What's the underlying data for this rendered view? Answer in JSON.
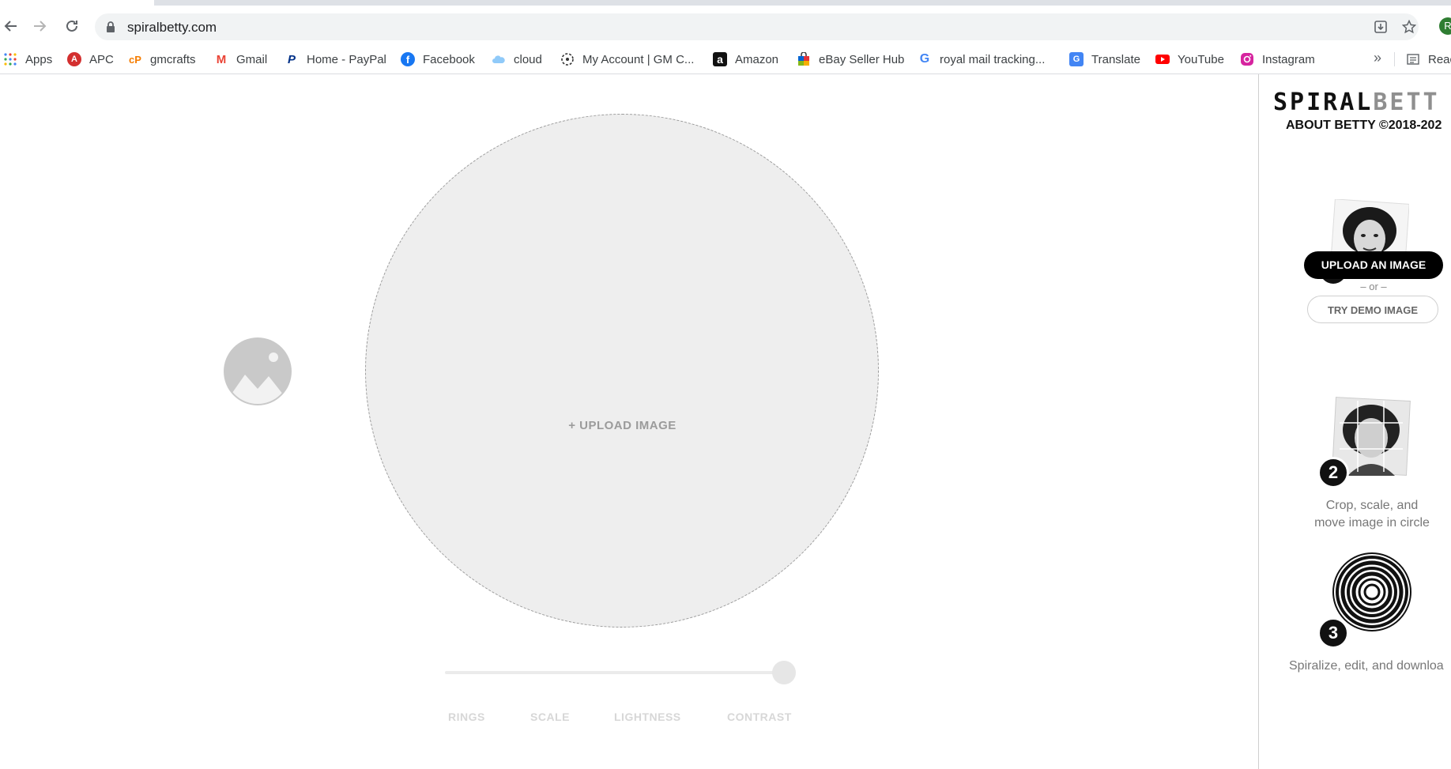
{
  "browser": {
    "url": "spiralbetty.com",
    "avatar_initial": "R"
  },
  "bookmarks": [
    {
      "label": "Apps",
      "icon": "apps-grid-icon"
    },
    {
      "label": "APC",
      "icon": "apc-icon"
    },
    {
      "label": "gmcrafts",
      "icon": "gmcrafts-icon"
    },
    {
      "label": "Gmail",
      "icon": "gmail-icon"
    },
    {
      "label": "Home - PayPal",
      "icon": "paypal-icon"
    },
    {
      "label": "Facebook",
      "icon": "facebook-icon"
    },
    {
      "label": "cloud",
      "icon": "cloud-icon"
    },
    {
      "label": "My Account | GM C...",
      "icon": "account-icon"
    },
    {
      "label": "Amazon",
      "icon": "amazon-icon"
    },
    {
      "label": "eBay Seller Hub",
      "icon": "ebay-icon"
    },
    {
      "label": "royal mail tracking...",
      "icon": "google-icon"
    },
    {
      "label": "Translate",
      "icon": "translate-icon"
    },
    {
      "label": "YouTube",
      "icon": "youtube-icon"
    },
    {
      "label": "Instagram",
      "icon": "instagram-icon"
    },
    {
      "label": "Reac",
      "icon": "reading-list-icon"
    }
  ],
  "bookmarks_more": "»",
  "main": {
    "upload_label": "+ UPLOAD IMAGE",
    "controls": [
      "RINGS",
      "SCALE",
      "LIGHTNESS",
      "CONTRAST"
    ],
    "slider_value": 1.0
  },
  "sidebar": {
    "logo_part1": "SPIRAL",
    "logo_part2": "BETT",
    "about": "ABOUT BETTY ©2018-202",
    "step1_badge": "1",
    "upload_button": "UPLOAD AN IMAGE",
    "or_text": "– or –",
    "demo_button": "TRY DEMO IMAGE",
    "step2_badge": "2",
    "step2_line1": "Crop, scale, and",
    "step2_line2": "move image in circle",
    "step3_badge": "3",
    "step3_text": "Spiralize, edit, and downloa"
  },
  "colors": {
    "accent": "#000000",
    "circle_bg": "#eeeeee",
    "muted": "#9b9b9b"
  }
}
